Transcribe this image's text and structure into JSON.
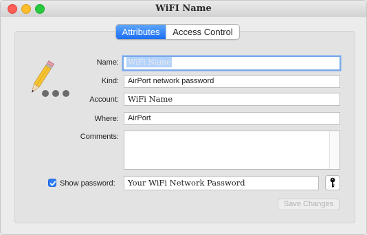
{
  "window": {
    "title": "WiFI Name"
  },
  "tabs": [
    {
      "label": "Attributes",
      "active": true
    },
    {
      "label": "Access Control",
      "active": false
    }
  ],
  "form": {
    "name_label": "Name:",
    "name_value": "WiFi Name",
    "kind_label": "Kind:",
    "kind_value": "AirPort network password",
    "account_label": "Account:",
    "account_value": "WiFi Name",
    "where_label": "Where:",
    "where_value": "AirPort",
    "comments_label": "Comments:",
    "comments_value": "",
    "show_password_label": "Show password:",
    "show_password_checked": true,
    "password_value": "Your WiFi Network Password"
  },
  "buttons": {
    "save_label": "Save Changes"
  },
  "icons": {
    "item_icon": "pencil-ellipsis-icon",
    "key_icon": "key-icon"
  },
  "colors": {
    "accent": "#1a6ef4",
    "selection": "#b3d3fd"
  }
}
